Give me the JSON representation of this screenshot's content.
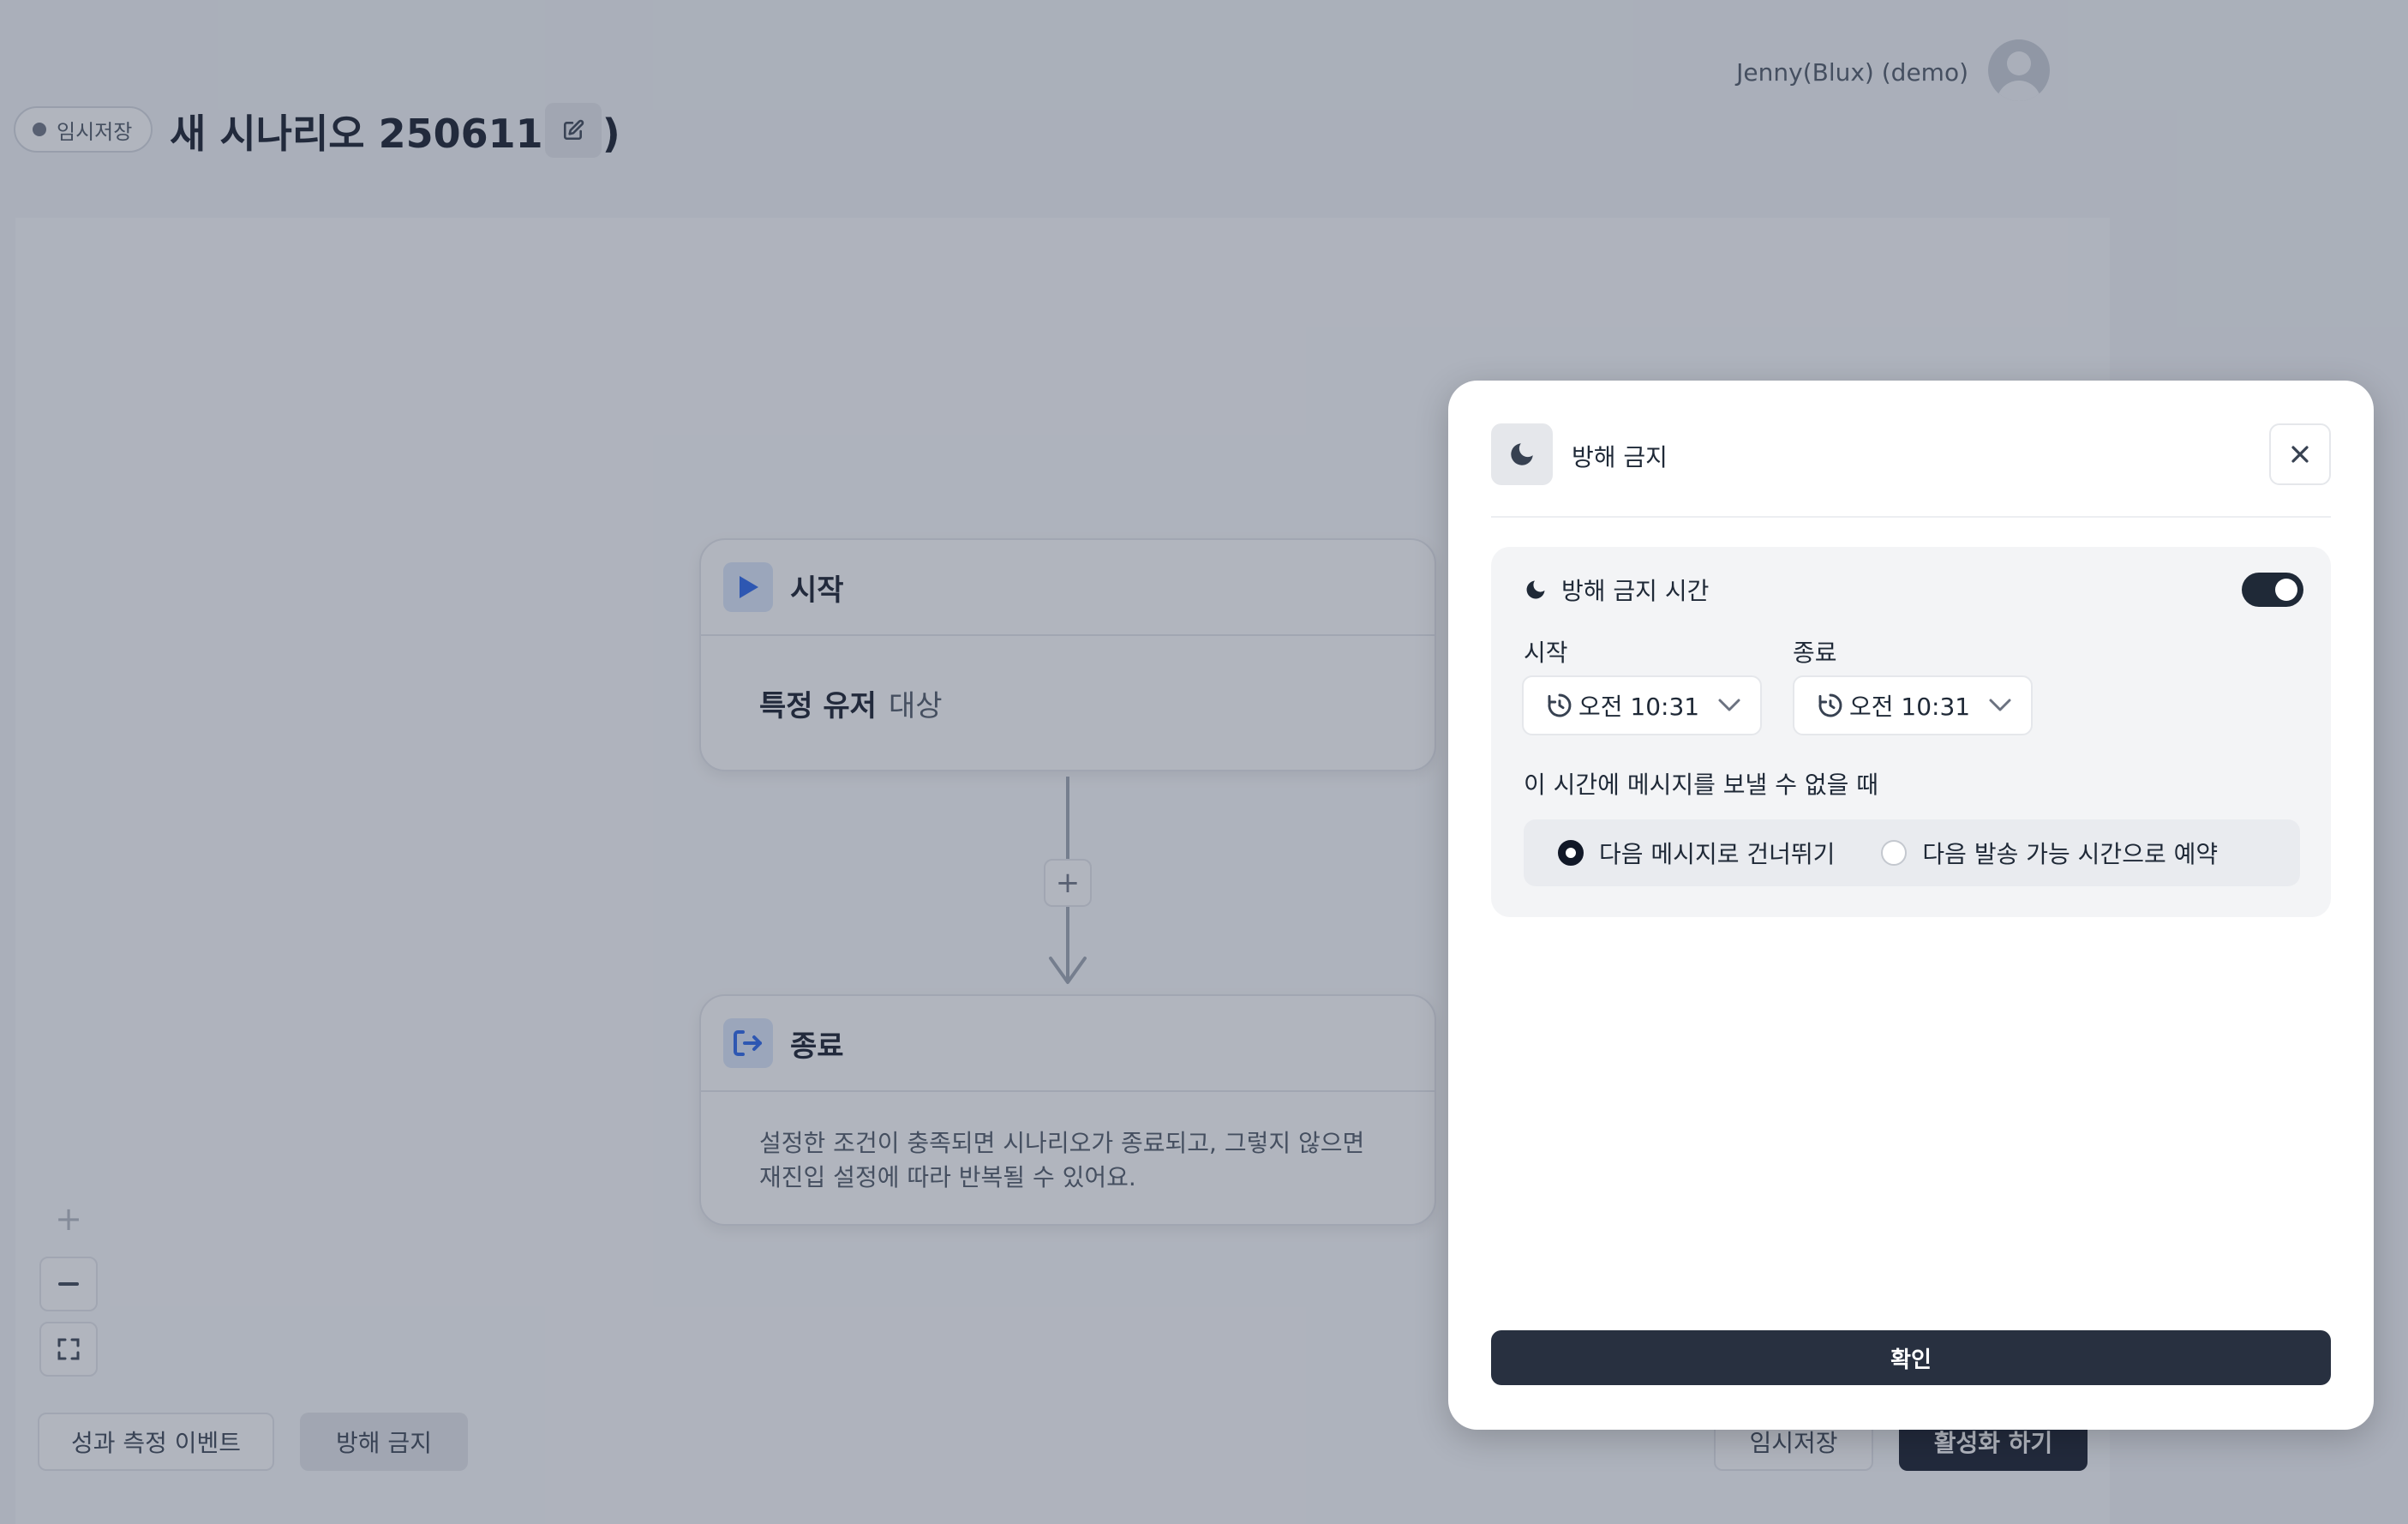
{
  "header": {
    "user_name": "Jenny(Blux) (demo)",
    "draft_badge": "임시저장",
    "title": "새 시나리오 250611 (1)",
    "icons": {
      "avatar": "user-avatar-icon",
      "edit": "pencil-square-icon"
    }
  },
  "canvas": {
    "start_node": {
      "title": "시작",
      "body_strong": "특정 유저",
      "body_rest": "대상",
      "icon": "play-icon"
    },
    "add_step_label": "+",
    "end_node": {
      "title": "종료",
      "body_line1": "설정한 조건이 충족되면 시나리오가 종료되고, 그렇지 않으면",
      "body_line2": "재진입 설정에 따라 반복될 수 있어요.",
      "icon": "exit-icon"
    },
    "zoom_controls": {
      "zoom_in": "+",
      "zoom_out_icon": "minus-icon",
      "fit_icon": "fullscreen-icon"
    }
  },
  "bottom_bar": {
    "metric_event": "성과 측정 이벤트",
    "do_not_disturb": "방해 금지",
    "save_draft": "임시저장",
    "activate": "활성화 하기"
  },
  "panel": {
    "title": "방해 금지",
    "header_icon": "moon-icon",
    "close_icon": "close-icon",
    "quiet_hours": {
      "label": "방해 금지 시간",
      "enabled": true,
      "start": {
        "label": "시작",
        "value": "오전 10:31"
      },
      "end": {
        "label": "종료",
        "value": "오전 10:31"
      }
    },
    "fallback": {
      "question": "이 시간에 메시지를 보낼 수 없을 때",
      "options": [
        "다음 메시지로 건너뛰기",
        "다음 발송 가능 시간으로 예약"
      ],
      "selected_index": 0
    },
    "confirm": "확인"
  },
  "colors": {
    "accent_dark": "#111827",
    "confirm_button": "#283040",
    "node_icon": "#2563eb",
    "node_icon_bg": "#dbe7fb",
    "overlay": "#3c465c"
  }
}
